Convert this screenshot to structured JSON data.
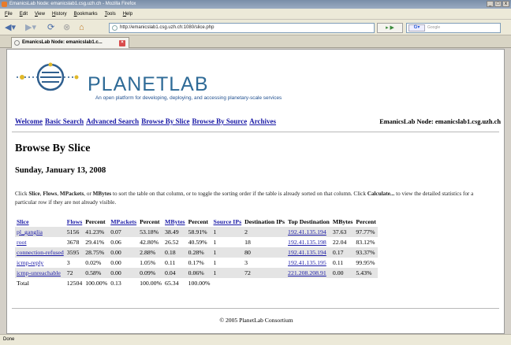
{
  "window": {
    "title": "EmanicsLab Node: emanicslab1.csg.uzh.ch - Mozilla Firefox",
    "controls": [
      "_",
      "□",
      "x"
    ]
  },
  "menu": [
    "File",
    "Edit",
    "View",
    "History",
    "Bookmarks",
    "Tools",
    "Help"
  ],
  "toolbar": {
    "url": "http://emanicslab1.csg.uzh.ch:1080/slice.php",
    "search_placeholder": "Google",
    "search_engine_label": "G▾",
    "go_label": "▸ ▶"
  },
  "tab": {
    "title": "EmanicsLab Node: emanicslab1.c...",
    "close": "×"
  },
  "header": {
    "brand": "PLANETLAB",
    "tagline": "An open platform for developing, deploying, and accessing planetary-scale services",
    "nav_links": [
      "Welcome",
      "Basic Search",
      "Advanced Search",
      "Browse By Slice",
      "Browse By Source",
      "Archives"
    ],
    "node": "EmanicsLab Node: emanicslab1.csg.uzh.ch"
  },
  "main": {
    "title": "Browse By Slice",
    "date": "Sunday, January 13, 2008",
    "instructions_1": "Click ",
    "instructions_slice": "Slice",
    "instructions_2": ", ",
    "instructions_flows": "Flows",
    "instructions_3": ", ",
    "instructions_mpackets": "MPackets",
    "instructions_4": ", or ",
    "instructions_mbytes": "MBytes",
    "instructions_5": " to sort the table on that column, or to toggle the sorting order if the table is already sorted on that column. Click ",
    "instructions_calc": "Calculate...",
    "instructions_6": " to view the detailed statistics for a particular row if they are not already visible."
  },
  "table": {
    "headers": [
      "Slice",
      "Flows",
      "Percent",
      "MPackets",
      "Percent",
      "MBytes",
      "Percent",
      "Source IPs",
      "Destination IPs",
      "Top Destination",
      "MBytes",
      "Percent"
    ],
    "rows": [
      [
        "pl_ganglia",
        "5156",
        "41.23%",
        "0.07",
        "53.18%",
        "38.49",
        "58.91%",
        "1",
        "2",
        "192.41.135.194",
        "37.63",
        "97.77%"
      ],
      [
        "root",
        "3678",
        "29.41%",
        "0.06",
        "42.80%",
        "26.52",
        "40.59%",
        "1",
        "18",
        "192.41.135.198",
        "22.04",
        "83.12%"
      ],
      [
        "connection-refused",
        "3595",
        "28.75%",
        "0.00",
        "2.88%",
        "0.18",
        "0.28%",
        "1",
        "80",
        "192.41.135.194",
        "0.17",
        "93.37%"
      ],
      [
        "icmp-reply",
        "3",
        "0.02%",
        "0.00",
        "1.05%",
        "0.11",
        "0.17%",
        "1",
        "3",
        "192.41.135.195",
        "0.11",
        "99.95%"
      ],
      [
        "icmp-unreachable",
        "72",
        "0.58%",
        "0.00",
        "0.09%",
        "0.04",
        "0.06%",
        "1",
        "72",
        "221.208.208.91",
        "0.00",
        "5.43%"
      ]
    ],
    "total": [
      "Total",
      "12504",
      "100.00%",
      "0.13",
      "100.00%",
      "65.34",
      "100.00%"
    ]
  },
  "footer": "© 2005 PlanetLab Consortium",
  "status": "Done"
}
